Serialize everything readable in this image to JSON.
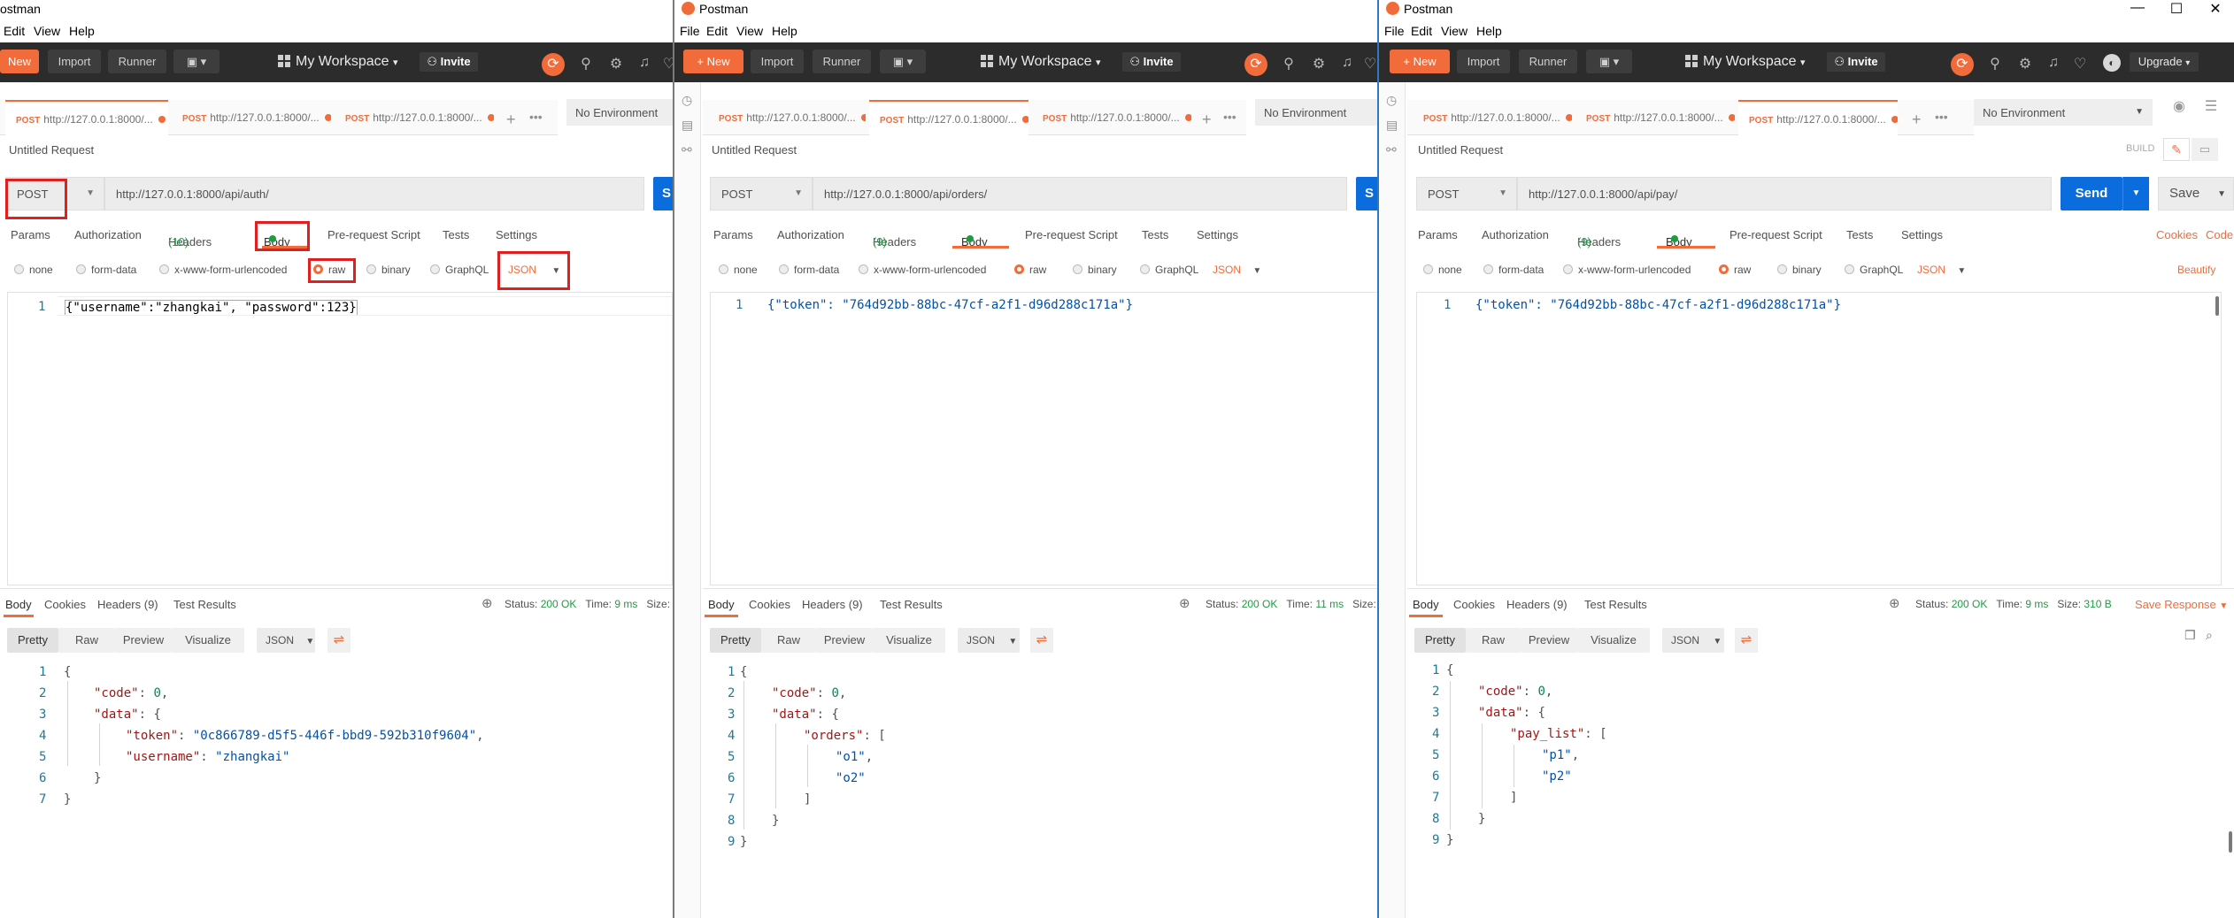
{
  "app": {
    "name": "Postman",
    "menu": [
      "File",
      "Edit",
      "View",
      "Help"
    ],
    "win0_menu": [
      "Edit",
      "View",
      "Help"
    ],
    "win0_title": "ostman"
  },
  "toolbar": {
    "new": "New",
    "import": "Import",
    "runner": "Runner",
    "workspace": "My Workspace",
    "invite": "Invite",
    "upgrade": "Upgrade"
  },
  "env": {
    "none": "No Environment"
  },
  "tabs": {
    "method": "POST",
    "label": "http://127.0.0.1:8000/..."
  },
  "request": {
    "title": "Untitled Request",
    "build": "BUILD",
    "method": "POST",
    "send": "Send",
    "save": "Save"
  },
  "reqtabs": {
    "params": "Params",
    "auth": "Authorization",
    "headers": "Headers",
    "body": "Body",
    "prereq": "Pre-request Script",
    "tests": "Tests",
    "settings": "Settings",
    "cookies": "Cookies",
    "code": "Code"
  },
  "bodyopts": {
    "none": "none",
    "formdata": "form-data",
    "urlenc": "x-www-form-urlencoded",
    "raw": "raw",
    "binary": "binary",
    "graphql": "GraphQL",
    "json": "JSON",
    "beautify": "Beautify"
  },
  "resptabs": {
    "body": "Body",
    "cookies": "Cookies",
    "headers": "Headers (9)",
    "tests": "Test Results"
  },
  "status": {
    "status_label": "Status:",
    "status_value": "200 OK",
    "time_label": "Time:",
    "size_label": "Size:",
    "save_response": "Save Response"
  },
  "view": {
    "pretty": "Pretty",
    "raw": "Raw",
    "preview": "Preview",
    "visualize": "Visualize",
    "json": "JSON"
  },
  "windows": [
    {
      "url": "http://127.0.0.1:8000/api/auth/",
      "headers_count": "(10)",
      "time": "9 ms",
      "body_code": "{\"username\":\"zhangkai\", \"password\":123}"
    },
    {
      "url": "http://127.0.0.1:8000/api/orders/",
      "headers_count": "(9)",
      "time": "11 ms",
      "body_code": "{\"token\": \"764d92bb-88bc-47cf-a2f1-d96d288c171a\"}"
    },
    {
      "url": "http://127.0.0.1:8000/api/pay/",
      "headers_count": "(9)",
      "time": "9 ms",
      "size": "310 B",
      "body_code": "{\"token\": \"764d92bb-88bc-47cf-a2f1-d96d288c171a\"}"
    }
  ],
  "resp0": {
    "token_key": "\"token\"",
    "token_val": "\"0c866789-d5f5-446f-bbd9-592b310f9604\"",
    "user_key": "\"username\"",
    "user_val": "\"zhangkai\""
  },
  "resp1": {
    "list_key": "\"orders\"",
    "v1": "\"o1\"",
    "v2": "\"o2\""
  },
  "resp2": {
    "list_key": "\"pay_list\"",
    "v1": "\"p1\"",
    "v2": "\"p2\""
  },
  "json": {
    "code_key": "\"code\"",
    "code_val": "0",
    "data_key": "\"data\"",
    "open": "{",
    "close": "}",
    "lopen": "[",
    "lclose": "]",
    "colon": ": ",
    "comma": ","
  },
  "line_numbers": [
    "1",
    "2",
    "3",
    "4",
    "5",
    "6",
    "7",
    "8",
    "9"
  ],
  "icons": {
    "sync": "sync-icon",
    "satellite": "satellite-icon",
    "settings": "settings-icon",
    "bell": "bell-icon",
    "heart": "heart-icon",
    "history": "history-icon",
    "collections": "collections-icon",
    "apis": "apis-icon",
    "eye": "eye-icon",
    "sliders": "sliders-icon",
    "globe": "globe-icon",
    "wrap": "wrap-icon",
    "copy": "copy-icon",
    "search": "search-icon"
  }
}
